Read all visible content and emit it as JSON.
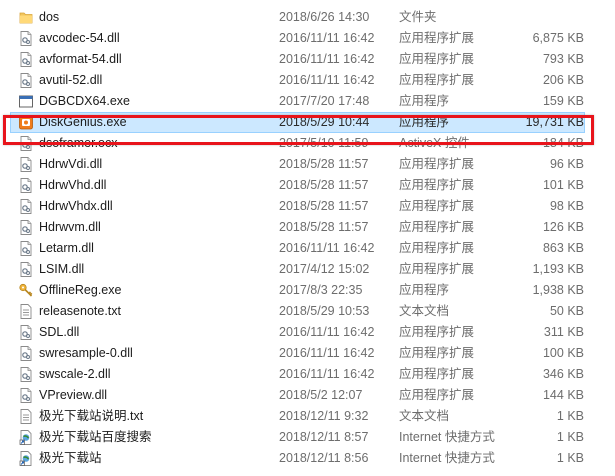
{
  "files": [
    {
      "name": "dos",
      "date": "2018/6/26 14:30",
      "type": "文件夹",
      "size": "",
      "icon": "folder-icon"
    },
    {
      "name": "avcodec-54.dll",
      "date": "2016/11/11 16:42",
      "type": "应用程序扩展",
      "size": "6,875 KB",
      "icon": "dll-file-icon"
    },
    {
      "name": "avformat-54.dll",
      "date": "2016/11/11 16:42",
      "type": "应用程序扩展",
      "size": "793 KB",
      "icon": "dll-file-icon"
    },
    {
      "name": "avutil-52.dll",
      "date": "2016/11/11 16:42",
      "type": "应用程序扩展",
      "size": "206 KB",
      "icon": "dll-file-icon"
    },
    {
      "name": "DGBCDX64.exe",
      "date": "2017/7/20 17:48",
      "type": "应用程序",
      "size": "159 KB",
      "icon": "exe-window-icon"
    },
    {
      "name": "DiskGenius.exe",
      "date": "2018/5/29 10:44",
      "type": "应用程序",
      "size": "19,731 KB",
      "icon": "diskgenius-icon"
    },
    {
      "name": "dsoframer.ocx",
      "date": "2017/5/10 11:59",
      "type": "ActiveX 控件",
      "size": "184 KB",
      "icon": "ocx-file-icon"
    },
    {
      "name": "HdrwVdi.dll",
      "date": "2018/5/28 11:57",
      "type": "应用程序扩展",
      "size": "96 KB",
      "icon": "dll-file-icon"
    },
    {
      "name": "HdrwVhd.dll",
      "date": "2018/5/28 11:57",
      "type": "应用程序扩展",
      "size": "101 KB",
      "icon": "dll-file-icon"
    },
    {
      "name": "HdrwVhdx.dll",
      "date": "2018/5/28 11:57",
      "type": "应用程序扩展",
      "size": "98 KB",
      "icon": "dll-file-icon"
    },
    {
      "name": "Hdrwvm.dll",
      "date": "2018/5/28 11:57",
      "type": "应用程序扩展",
      "size": "126 KB",
      "icon": "dll-file-icon"
    },
    {
      "name": "Letarm.dll",
      "date": "2016/11/11 16:42",
      "type": "应用程序扩展",
      "size": "863 KB",
      "icon": "dll-file-icon"
    },
    {
      "name": "LSIM.dll",
      "date": "2017/4/12 15:02",
      "type": "应用程序扩展",
      "size": "1,193 KB",
      "icon": "dll-file-icon"
    },
    {
      "name": "OfflineReg.exe",
      "date": "2017/8/3 22:35",
      "type": "应用程序",
      "size": "1,938 KB",
      "icon": "key-icon"
    },
    {
      "name": "releasenote.txt",
      "date": "2018/5/29 10:53",
      "type": "文本文档",
      "size": "50 KB",
      "icon": "text-file-icon"
    },
    {
      "name": "SDL.dll",
      "date": "2016/11/11 16:42",
      "type": "应用程序扩展",
      "size": "311 KB",
      "icon": "dll-file-icon"
    },
    {
      "name": "swresample-0.dll",
      "date": "2016/11/11 16:42",
      "type": "应用程序扩展",
      "size": "100 KB",
      "icon": "dll-file-icon"
    },
    {
      "name": "swscale-2.dll",
      "date": "2016/11/11 16:42",
      "type": "应用程序扩展",
      "size": "346 KB",
      "icon": "dll-file-icon"
    },
    {
      "name": "VPreview.dll",
      "date": "2018/5/2 12:07",
      "type": "应用程序扩展",
      "size": "144 KB",
      "icon": "dll-file-icon"
    },
    {
      "name": "极光下载站说明.txt",
      "date": "2018/12/11 9:32",
      "type": "文本文档",
      "size": "1 KB",
      "icon": "text-file-icon"
    },
    {
      "name": "极光下载站百度搜索",
      "date": "2018/12/11 8:57",
      "type": "Internet 快捷方式",
      "size": "1 KB",
      "icon": "internet-shortcut-icon"
    },
    {
      "name": "极光下载站",
      "date": "2018/12/11 8:56",
      "type": "Internet 快捷方式",
      "size": "1 KB",
      "icon": "internet-shortcut-icon"
    }
  ],
  "selected_index": 5,
  "colors": {
    "selection": "#cce8ff",
    "highlight_border": "#e8141b"
  }
}
